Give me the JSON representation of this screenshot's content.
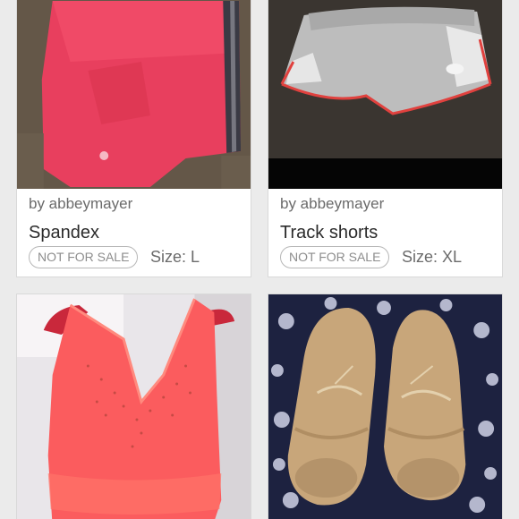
{
  "listings": [
    {
      "author": "by abbeymayer",
      "title": "Spandex",
      "status_badge": "NOT FOR SALE",
      "size_label": "Size:",
      "size_value": "L",
      "image_icon": "pink-spandex-shorts-photo"
    },
    {
      "author": "by abbeymayer",
      "title": "Track shorts",
      "status_badge": "NOT FOR SALE",
      "size_label": "Size:",
      "size_value": "XL",
      "image_icon": "gray-track-shorts-photo"
    },
    {
      "image_icon": "coral-sequin-tank-top-photo"
    },
    {
      "image_icon": "tan-lace-up-shoes-photo"
    }
  ],
  "colors": {
    "page_background": "#ebebeb",
    "card_background": "#ffffff",
    "badge_border": "#b7b7b7",
    "text_primary": "#2b2b2b",
    "text_secondary": "#6b6b6b"
  }
}
